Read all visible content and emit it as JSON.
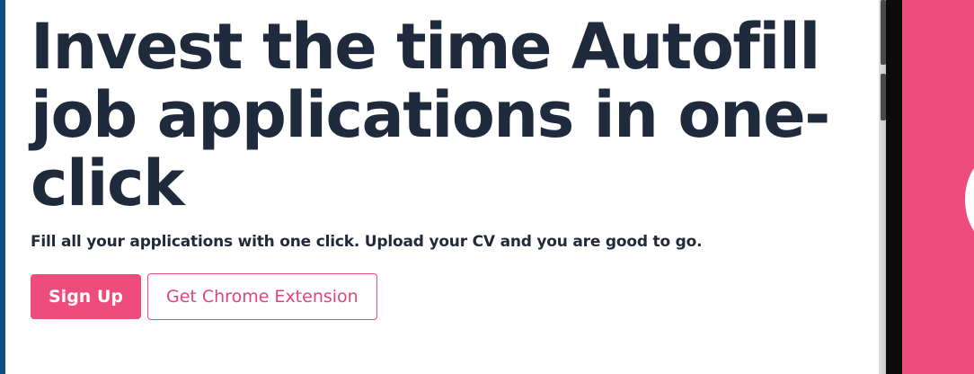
{
  "hero": {
    "title": "Invest the time Autofill job applications in one-click",
    "subtitle": "Fill all your applications with one click. Upload your CV and you are good to go."
  },
  "actions": {
    "signup_label": "Sign Up",
    "extension_label": "Get Chrome Extension"
  },
  "colors": {
    "brand_pink": "#ee4c7c",
    "text_dark": "#1f2a3c",
    "edge_blue": "#0f4c81"
  }
}
